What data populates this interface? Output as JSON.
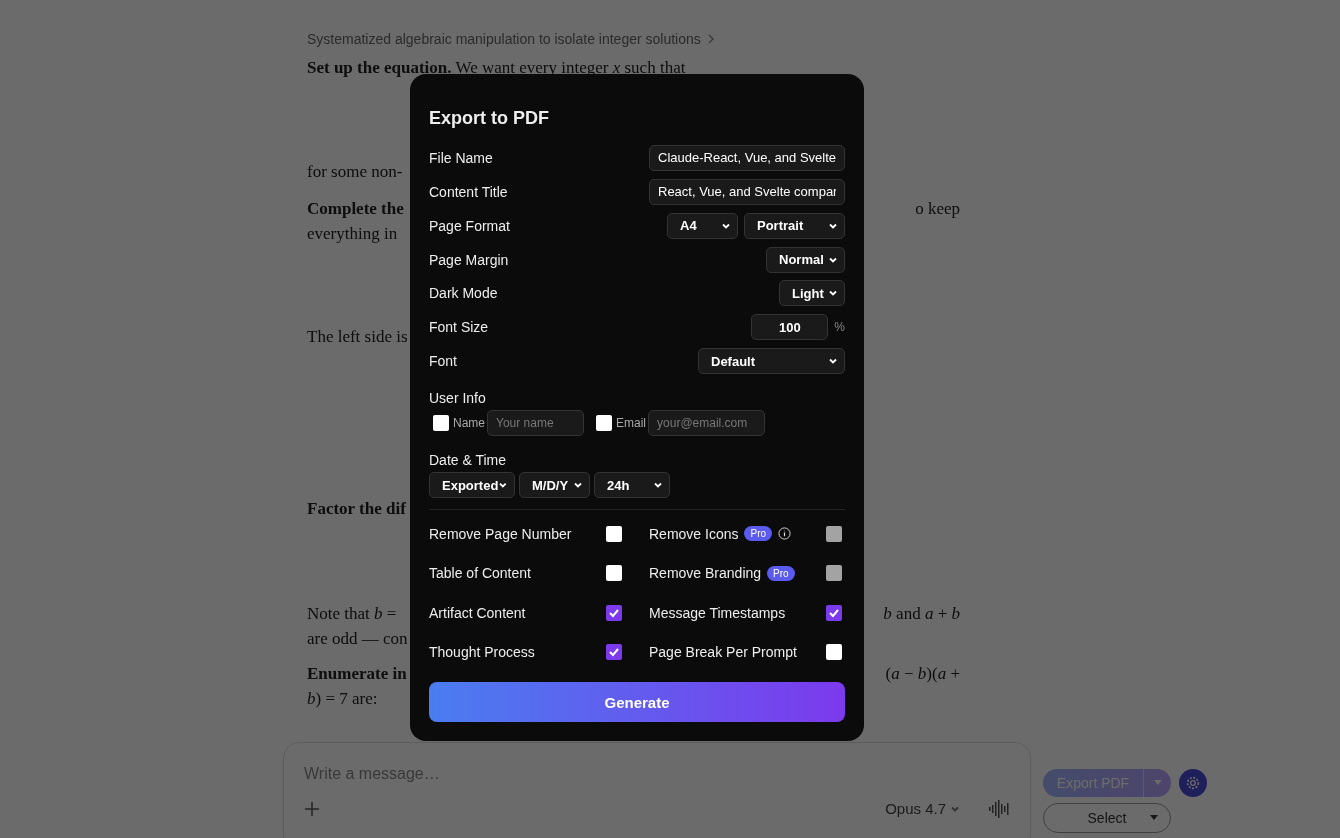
{
  "article": {
    "breadcrumb": "Systematized algebraic manipulation to isolate integer solutions",
    "lines": [
      {
        "left": "**Set up the equation.** We want every integer *x* such that"
      },
      {
        "left": "for some non-"
      },
      {
        "left": "**Complete the**",
        "right": "o keep"
      },
      {
        "left": "everything in"
      },
      {
        "left": "The left side is"
      },
      {
        "left": "**Factor the dif**"
      },
      {
        "left": "Note that *b* =",
        "right": "*b* and *a* + *b*"
      },
      {
        "left": "are odd — con"
      },
      {
        "left": "**Enumerate in**",
        "right": "(*a* − *b*)(*a* +"
      },
      {
        "left": "*b*) = 7 are:"
      }
    ]
  },
  "dialog": {
    "title": "Export to PDF",
    "rows": [
      {
        "kind": "input",
        "label": "File Name",
        "value": "Claude-React, Vue, and Svelte"
      },
      {
        "kind": "input",
        "label": "Content Title",
        "value": "React, Vue, and Svelte compar"
      },
      {
        "kind": "select",
        "label": "Page Format",
        "selects": [
          "A4",
          "Portrait"
        ]
      },
      {
        "kind": "select",
        "label": "Page Margin",
        "selects": [
          "Normal"
        ]
      },
      {
        "kind": "select",
        "label": "Dark Mode",
        "selects": [
          "Light"
        ]
      },
      {
        "kind": "number",
        "label": "Font Size",
        "value": "100",
        "unit": "%"
      },
      {
        "kind": "select",
        "label": "Font",
        "selects": [
          "Default"
        ]
      }
    ],
    "user_info": {
      "label": "User Info",
      "fields": [
        {
          "label": "Name",
          "checked": false,
          "placeholder": "Your name"
        },
        {
          "label": "Email",
          "checked": false,
          "placeholder": "your@email.com"
        }
      ]
    },
    "date_time": {
      "label": "Date & Time",
      "selects": [
        "Exported",
        "M/D/Y",
        "24h"
      ]
    },
    "options": [
      {
        "label": "Remove Page Number",
        "checked": false,
        "disabled": false
      },
      {
        "label": "Remove Icons",
        "badge": "Pro",
        "info": true,
        "checked": false,
        "disabled": true
      },
      {
        "label": "Table of Content",
        "checked": false,
        "disabled": false
      },
      {
        "label": "Remove Branding",
        "badge": "Pro",
        "checked": false,
        "disabled": true
      },
      {
        "label": "Artifact Content",
        "checked": true,
        "disabled": false
      },
      {
        "label": "Message Timestamps",
        "checked": true,
        "disabled": false
      },
      {
        "label": "Thought Process",
        "checked": true,
        "disabled": false
      },
      {
        "label": "Page Break Per Prompt",
        "checked": false,
        "disabled": false
      }
    ],
    "generate": "Generate"
  },
  "composer": {
    "placeholder": "Write a message…",
    "model": "Opus 4.7"
  },
  "side": {
    "export": "Export PDF",
    "select": "Select"
  }
}
